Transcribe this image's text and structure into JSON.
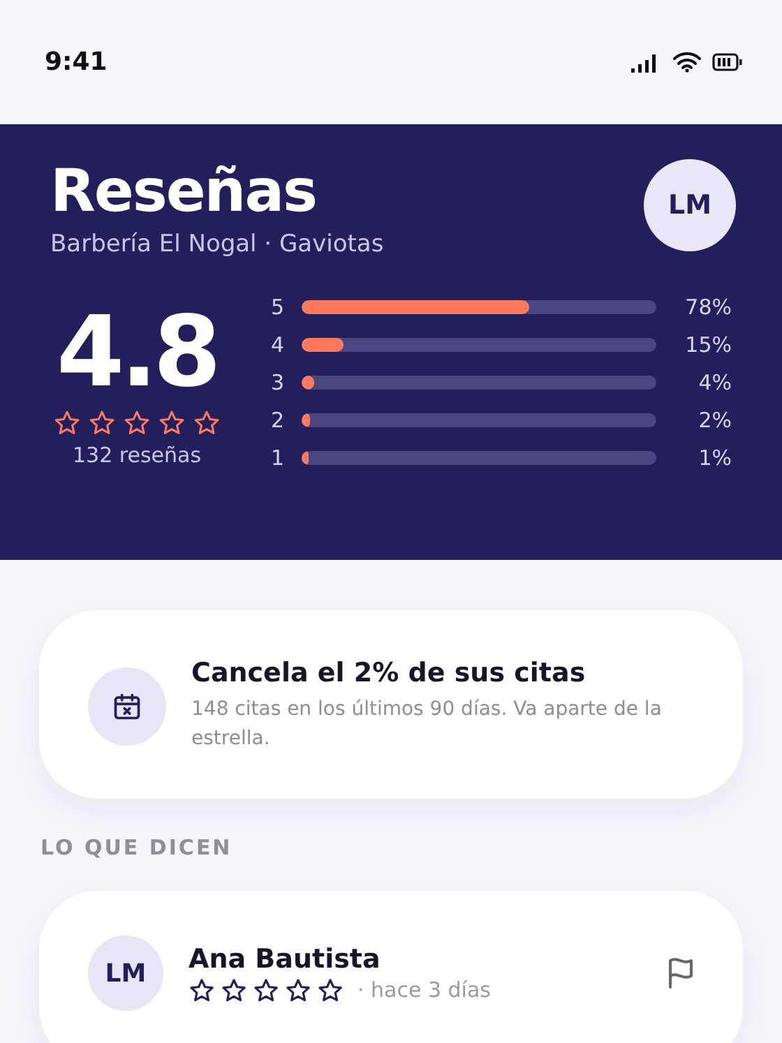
{
  "status_bar": {
    "time": "9:41"
  },
  "header": {
    "title": "Reseñas",
    "subtitle": "Barbería El Nogal · Gaviotas",
    "avatar": "LM",
    "rating": "4.8",
    "stars": 0,
    "count": "132 reseñas",
    "distribution": [
      {
        "label": "5",
        "level": 0.64,
        "reading": "78%"
      },
      {
        "label": "4",
        "level": 0.12,
        "reading": "15%"
      },
      {
        "label": "3",
        "level": 0.035,
        "reading": "4%"
      },
      {
        "label": "2",
        "level": 0.025,
        "reading": "2%"
      },
      {
        "label": "1",
        "level": 0.02,
        "reading": "1%"
      }
    ]
  },
  "notice": {
    "title": "Cancela el 2% de sus citas",
    "text": "148 citas en los últimos 90 días. Va aparte de la estrella."
  },
  "section_title": "LO QUE DICEN",
  "reviews": [
    {
      "avatar": "LM",
      "name": "Ana Bautista",
      "stars": 0,
      "time": "· hace 3 días"
    }
  ]
}
